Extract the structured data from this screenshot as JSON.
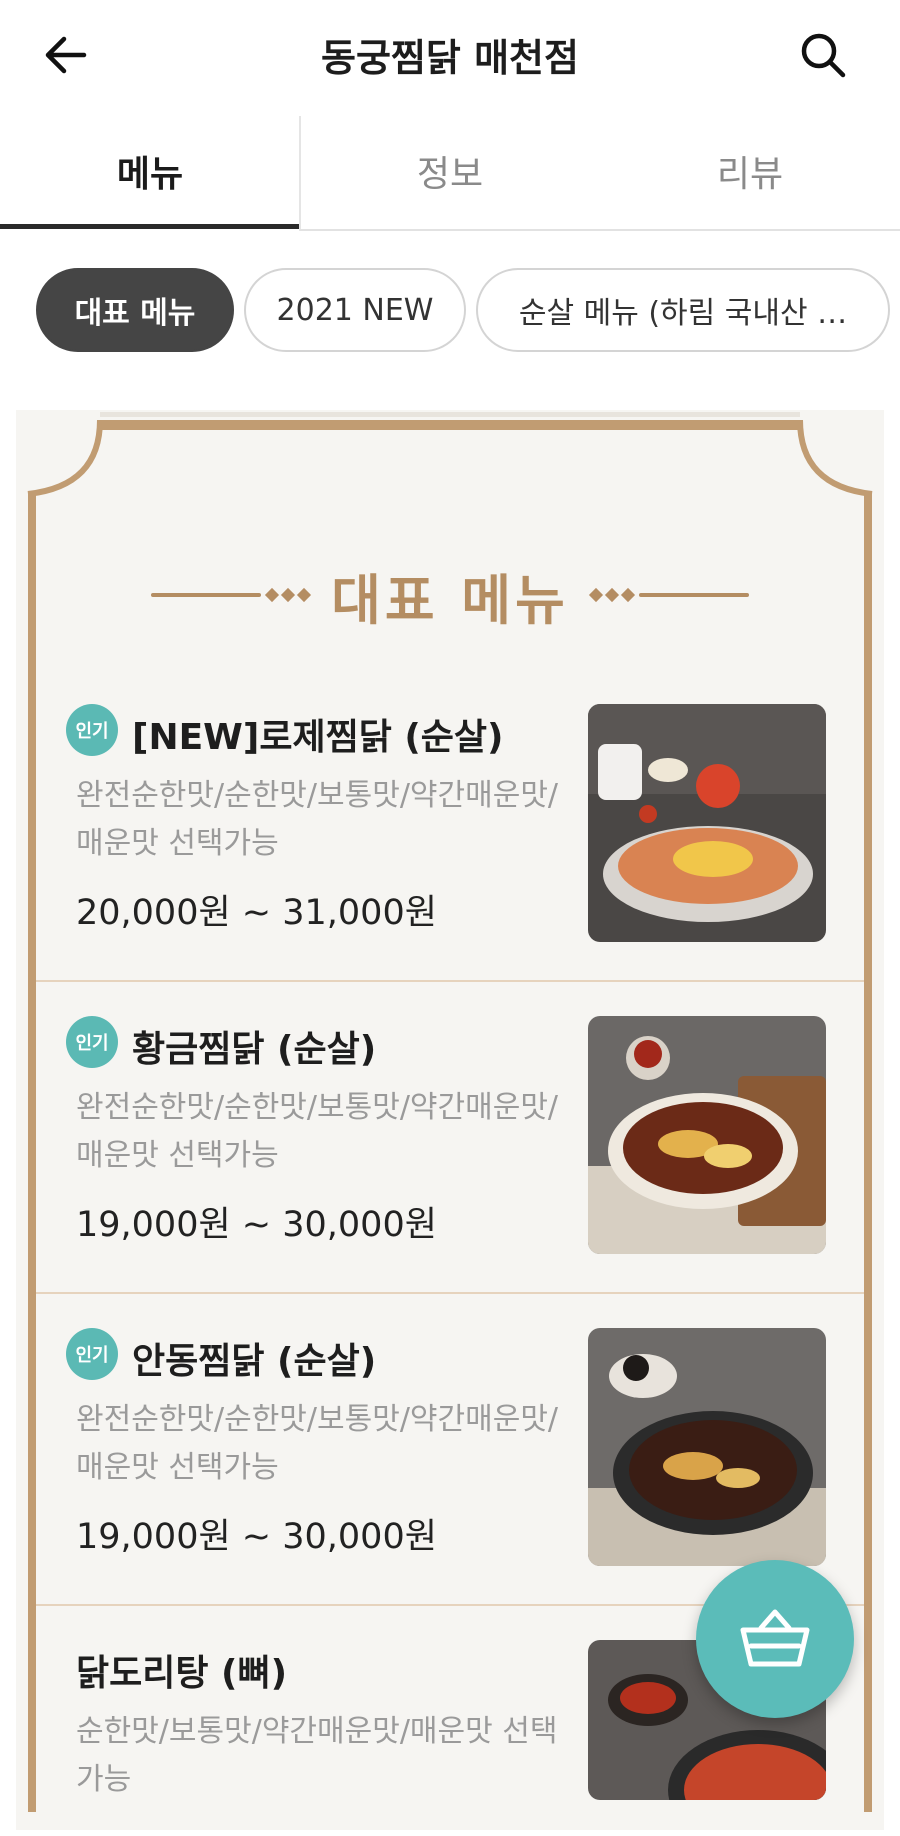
{
  "header": {
    "title": "동궁찜닭 매천점"
  },
  "tabs": [
    {
      "label": "메뉴"
    },
    {
      "label": "정보"
    },
    {
      "label": "리뷰"
    }
  ],
  "chips": [
    {
      "label": "대표 메뉴"
    },
    {
      "label": "2021 NEW"
    },
    {
      "label": "순살 메뉴 (하림 국내산 …"
    }
  ],
  "section": {
    "title": "대표 메뉴"
  },
  "menu_items": [
    {
      "badge": "인기",
      "name": "[NEW]로제찜닭 (순살)",
      "desc": "완전순한맛/순한맛/보통맛/약간매운맛/매운맛 선택가능",
      "price": "20,000원 ~ 31,000원"
    },
    {
      "badge": "인기",
      "name": "황금찜닭 (순살)",
      "desc": "완전순한맛/순한맛/보통맛/약간매운맛/매운맛 선택가능",
      "price": "19,000원 ~ 30,000원"
    },
    {
      "badge": "인기",
      "name": "안동찜닭 (순살)",
      "desc": "완전순한맛/순한맛/보통맛/약간매운맛/매운맛 선택가능",
      "price": "19,000원 ~ 30,000원"
    },
    {
      "badge": "",
      "name": "닭도리탕 (뼈)",
      "desc": "순한맛/보통맛/약간매운맛/매운맛 선택가능",
      "price": ""
    }
  ],
  "colors": {
    "accent": "#5bbcb9",
    "gold": "#b48d62",
    "chip_active": "#454545"
  },
  "icons": {
    "back": "arrow-left-icon",
    "search": "search-icon",
    "cart": "basket-icon"
  }
}
